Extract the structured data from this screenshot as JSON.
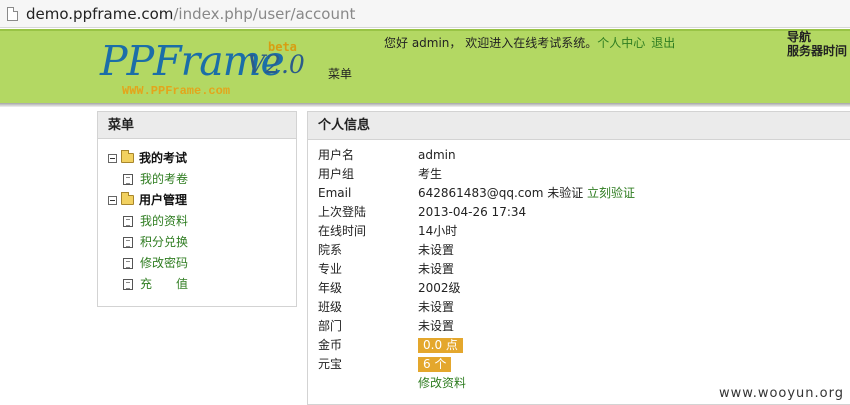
{
  "browser": {
    "url_host": "demo.ppframe.com",
    "url_path": "/index.php/user/account"
  },
  "header": {
    "logo_main": "PPFrame",
    "logo_version": "V2.0",
    "logo_beta": "beta",
    "logo_site": "WWW.PPFrame.com",
    "menu_label": "菜单",
    "welcome_text": "您好 admin， 欢迎进入在线考试系统。",
    "user_center_link": "个人中心",
    "logout_link": "退出",
    "nav_title": "导航",
    "server_time_label": "服务器时间"
  },
  "sidebar": {
    "title": "菜单",
    "groups": [
      {
        "label": "我的考试",
        "items": [
          {
            "label": "我的考卷"
          }
        ]
      },
      {
        "label": "用户管理",
        "items": [
          {
            "label": "我的资料"
          },
          {
            "label": "积分兑换"
          },
          {
            "label": "修改密码"
          },
          {
            "label": "充　　值"
          }
        ]
      }
    ]
  },
  "profile": {
    "title": "个人信息",
    "rows": [
      {
        "label": "用户名",
        "value": "admin"
      },
      {
        "label": "用户组",
        "value": "考生"
      },
      {
        "label": "Email",
        "value": "642861483@qq.com 未验证",
        "link": "立刻验证"
      },
      {
        "label": "上次登陆",
        "value": "2013-04-26 17:34"
      },
      {
        "label": "在线时间",
        "value": "14小时"
      },
      {
        "label": "院系",
        "value": "未设置"
      },
      {
        "label": "专业",
        "value": "未设置"
      },
      {
        "label": "年级",
        "value": "2002级"
      },
      {
        "label": "班级",
        "value": "未设置"
      },
      {
        "label": "部门",
        "value": "未设置"
      },
      {
        "label": "金币",
        "badge": "0.0 点"
      },
      {
        "label": "元宝",
        "badge": "6 个"
      }
    ],
    "edit_link": "修改资料"
  },
  "watermark": "www.wooyun.org",
  "colors": {
    "header_green": "#b3d863",
    "link_green": "#2f7d21",
    "badge_orange": "#e4a72d",
    "logo_blue": "#1b6ea8"
  }
}
